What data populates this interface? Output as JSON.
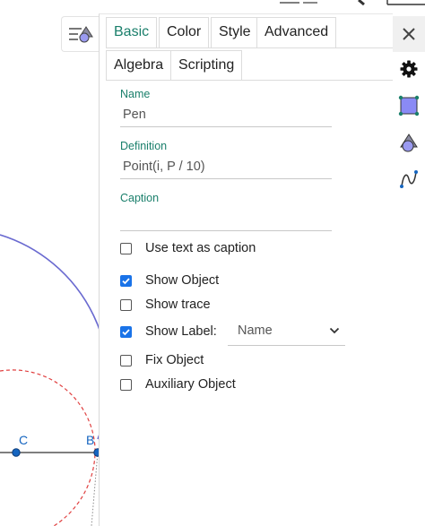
{
  "tabs": [
    {
      "label": "Basic",
      "active": true
    },
    {
      "label": "Color"
    },
    {
      "label": "Style"
    },
    {
      "label": "Advanced"
    },
    {
      "label": "Algebra"
    },
    {
      "label": "Scripting"
    }
  ],
  "fields": {
    "name_label": "Name",
    "name_value": "Pen",
    "definition_label": "Definition",
    "definition_value": "Point(i, P / 10)",
    "caption_label": "Caption",
    "caption_value": ""
  },
  "checkboxes": [
    {
      "label": "Use text as caption",
      "checked": false
    },
    {
      "label": "Show Object",
      "checked": true
    },
    {
      "label": "Show trace",
      "checked": false
    },
    {
      "label": "Show Label:",
      "checked": true
    },
    {
      "label": "Fix Object",
      "checked": false
    },
    {
      "label": "Auxiliary Object",
      "checked": false
    }
  ],
  "label_style": {
    "selected": "Name"
  },
  "graphics": {
    "point_c_label": "C",
    "point_b_label": "B"
  },
  "colors": {
    "accent": "#1a7f6b",
    "checkbox": "#1a73e8",
    "arc": "#6a6ad0",
    "dashed_circle": "#e04040",
    "point": "#1565c0"
  },
  "icons": {
    "toggle": "algebra-view-icon",
    "close": "close-icon",
    "settings": "gear-icon",
    "object": "square-object-icon",
    "shapes": "shapes-icon",
    "curve": "curve-icon"
  }
}
